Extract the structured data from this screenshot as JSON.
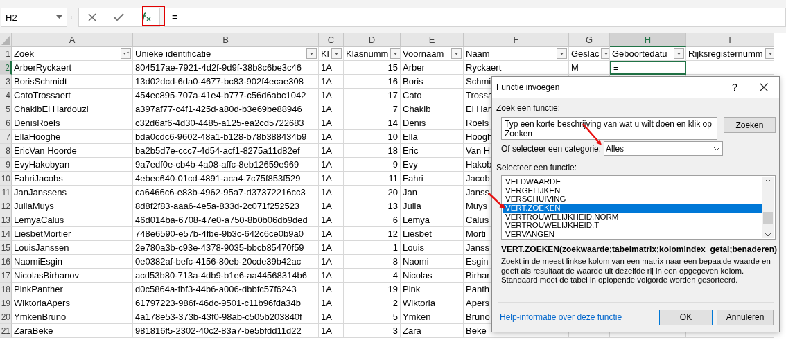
{
  "formula_bar": {
    "name_box": "H2",
    "formula": "="
  },
  "columns": [
    {
      "label": "A",
      "selected": false
    },
    {
      "label": "B",
      "selected": false
    },
    {
      "label": "C",
      "selected": false
    },
    {
      "label": "D",
      "selected": false
    },
    {
      "label": "E",
      "selected": false
    },
    {
      "label": "F",
      "selected": false
    },
    {
      "label": "G",
      "selected": false
    },
    {
      "label": "H",
      "selected": true
    },
    {
      "label": "I",
      "selected": false
    }
  ],
  "header_row": {
    "number": "1",
    "cells": [
      {
        "text": "Zoek",
        "kind": "sorted"
      },
      {
        "text": "Unieke identificatie",
        "kind": "filter"
      },
      {
        "text": "Kl",
        "kind": "filter"
      },
      {
        "text": "Klasnumm",
        "kind": "filter"
      },
      {
        "text": "Voornaam",
        "kind": "filter"
      },
      {
        "text": "Naam",
        "kind": "filter"
      },
      {
        "text": "Geslac",
        "kind": "filter"
      },
      {
        "text": "Geboortedatu",
        "kind": "filter"
      },
      {
        "text": "Rijksregisternumm",
        "kind": "filter"
      }
    ]
  },
  "rows": [
    {
      "number": "2",
      "selected": true,
      "cells": [
        "ArberRyckaert",
        "804517ae-7921-4d2f-9d9f-38b8c6be3c46",
        "1A",
        "15",
        "Arber",
        "Ryckaert",
        "M",
        "="
      ]
    },
    {
      "number": "3",
      "selected": false,
      "cells": [
        "BorisSchmidt",
        "13d02dcd-6da0-4677-bc83-902f4ecae308",
        "1A",
        "16",
        "Boris",
        "Schmi"
      ]
    },
    {
      "number": "4",
      "selected": false,
      "cells": [
        "CatoTrossaert",
        "454ec895-707a-41e4-b777-c56d6abc1042",
        "1A",
        "17",
        "Cato",
        "Trossa"
      ]
    },
    {
      "number": "5",
      "selected": false,
      "cells": [
        "ChakibEl Hardouzi",
        "a397af77-c4f1-425d-a80d-b3e69be88946",
        "1A",
        "7",
        "Chakib",
        "El Har"
      ]
    },
    {
      "number": "6",
      "selected": false,
      "cells": [
        "DenisRoels",
        "c32d6af6-4d30-4485-a125-ea2cd5722683",
        "1A",
        "14",
        "Denis",
        "Roels"
      ]
    },
    {
      "number": "7",
      "selected": false,
      "cells": [
        "EllaHooghe",
        "bda0cdc6-9602-48a1-b128-b78b388434b9",
        "1A",
        "10",
        "Ella",
        "Hoogh"
      ]
    },
    {
      "number": "8",
      "selected": false,
      "cells": [
        "EricVan Hoorde",
        "ba2b5d7e-ccc7-4d54-acf1-8275a11d82ef",
        "1A",
        "18",
        "Eric",
        "Van H"
      ]
    },
    {
      "number": "9",
      "selected": false,
      "cells": [
        "EvyHakobyan",
        "9a7edf0e-cb4b-4a08-affc-8eb12659e969",
        "1A",
        "9",
        "Evy",
        "Hakob"
      ]
    },
    {
      "number": "10",
      "selected": false,
      "cells": [
        "FahriJacobs",
        "4ebec640-01cd-4891-aca4-7c75f853f529",
        "1A",
        "11",
        "Fahri",
        "Jacob"
      ]
    },
    {
      "number": "11",
      "selected": false,
      "cells": [
        "JanJanssens",
        "ca6466c6-e83b-4962-95a7-d37372216cc3",
        "1A",
        "20",
        "Jan",
        "Janss"
      ]
    },
    {
      "number": "12",
      "selected": false,
      "cells": [
        "JuliaMuys",
        "8d8f2f83-aaa6-4e5a-833d-2c071f252523",
        "1A",
        "13",
        "Julia",
        "Muys"
      ]
    },
    {
      "number": "13",
      "selected": false,
      "cells": [
        "LemyaCalus",
        "46d014ba-6708-47e0-a750-8b0b06db9ded",
        "1A",
        "6",
        "Lemya",
        "Calus"
      ]
    },
    {
      "number": "14",
      "selected": false,
      "cells": [
        "LiesbetMortier",
        "748e6590-e57b-4fbe-9b3c-642c6ce0b9a0",
        "1A",
        "12",
        "Liesbet",
        "Morti"
      ]
    },
    {
      "number": "15",
      "selected": false,
      "cells": [
        "LouisJanssen",
        "2e780a3b-c93e-4378-9035-bbcb85470f59",
        "1A",
        "1",
        "Louis",
        "Janss"
      ]
    },
    {
      "number": "16",
      "selected": false,
      "cells": [
        "NaomiEsgin",
        "0e0382af-befc-4156-80eb-20cde39b42ac",
        "1A",
        "8",
        "Naomi",
        "Esgin"
      ]
    },
    {
      "number": "17",
      "selected": false,
      "cells": [
        "NicolasBirhanov",
        "acd53b80-713a-4db9-b1e6-aa44568314b6",
        "1A",
        "4",
        "Nicolas",
        "Birhar"
      ]
    },
    {
      "number": "18",
      "selected": false,
      "cells": [
        "PinkPanther",
        "d0c5864a-fbf3-44b6-a006-dbbfc57f6243",
        "1A",
        "19",
        "Pink",
        "Panth"
      ]
    },
    {
      "number": "19",
      "selected": false,
      "cells": [
        "WiktoriaApers",
        "61797223-986f-46dc-9501-c11b96fda34b",
        "1A",
        "2",
        "Wiktoria",
        "Apers"
      ]
    },
    {
      "number": "20",
      "selected": false,
      "cells": [
        "YmkenBruno",
        "4a178e53-373b-43f0-98ab-c505b203840f",
        "1A",
        "5",
        "Ymken",
        "Bruno"
      ]
    },
    {
      "number": "21",
      "selected": false,
      "cells": [
        "ZaraBeke",
        "981816f5-2302-40c2-83a7-be5bfdd11d22",
        "1A",
        "3",
        "Zara",
        "Beke"
      ]
    }
  ],
  "dialog": {
    "title": "Functie invoegen",
    "help": "?",
    "search_label": "Zoek een functie:",
    "search_value": "Typ een korte beschrijving van wat u wilt doen en klik op Zoeken",
    "search_button": "Zoeken",
    "category_label": "Of selecteer een categorie:",
    "category": "Alles",
    "list_label": "Selecteer een functie:",
    "functions": [
      {
        "name": "VELDWAARDE",
        "selected": false
      },
      {
        "name": "VERGELIJKEN",
        "selected": false
      },
      {
        "name": "VERSCHUIVING",
        "selected": false
      },
      {
        "name": "VERT.ZOEKEN",
        "selected": true
      },
      {
        "name": "VERTROUWELIJKHEID.NORM",
        "selected": false
      },
      {
        "name": "VERTROUWELIJKHEID.T",
        "selected": false
      },
      {
        "name": "VERVANGEN",
        "selected": false
      }
    ],
    "signature": "VERT.ZOEKEN(zoekwaarde;tabelmatrix;kolomindex_getal;benaderen)",
    "description": "Zoekt in de meest linkse kolom van een matrix naar een bepaalde waarde en geeft als resultaat de waarde uit dezelfde rij in een opgegeven kolom. Standaard moet de tabel in oplopende volgorde worden gesorteerd.",
    "help_link": "Help-informatie over deze functie",
    "buttons": [
      "OK",
      "Annuleren"
    ]
  }
}
